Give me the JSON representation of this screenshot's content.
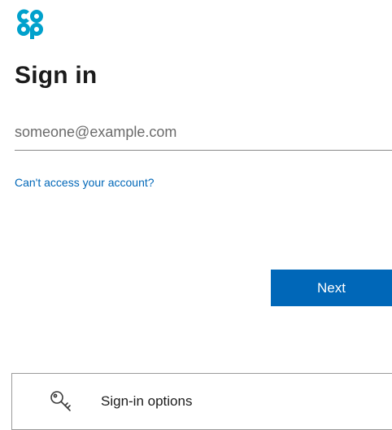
{
  "brand": {
    "logo_alt": "Co-op logo",
    "logo_color": "#00a1cc"
  },
  "signin": {
    "title": "Sign in",
    "email_value": "",
    "email_placeholder": "someone@example.com",
    "cant_access_link": "Can't access your account?",
    "next_button": "Next",
    "accent_color": "#0067b8"
  },
  "options": {
    "label": "Sign-in options",
    "icon": "key-icon"
  }
}
